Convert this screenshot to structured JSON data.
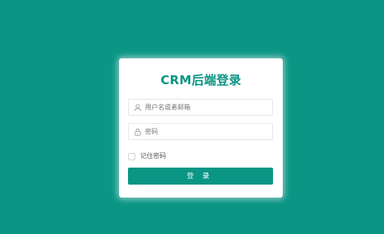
{
  "login": {
    "title": "CRM后端登录",
    "username": {
      "placeholder": "用户名或者邮箱",
      "value": "",
      "icon": "user-icon"
    },
    "password": {
      "placeholder": "密码",
      "value": "",
      "icon": "lock-icon"
    },
    "remember": {
      "label": "记住密码",
      "checked": false
    },
    "submit_label": "登 录"
  },
  "colors": {
    "background": "#0a9584",
    "accent": "#0a9584",
    "card": "#ffffff"
  }
}
